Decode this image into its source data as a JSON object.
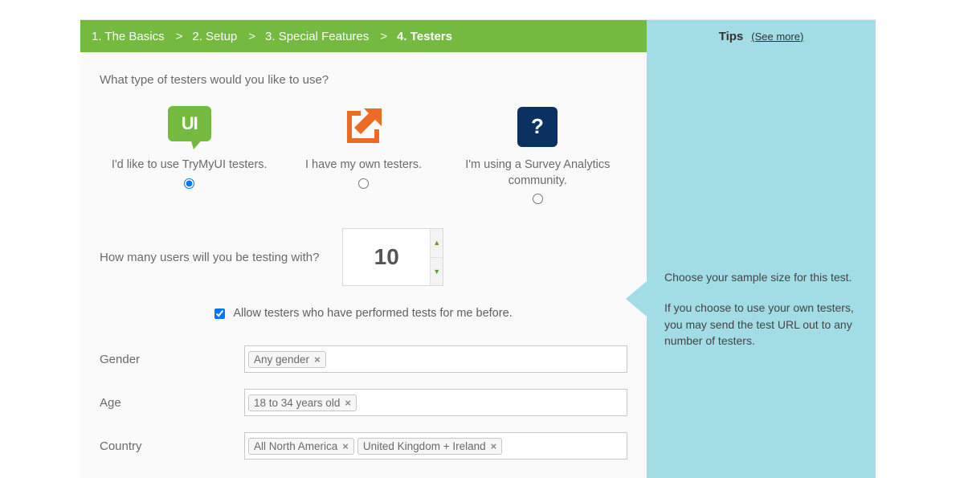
{
  "progress": {
    "steps": [
      "1. The Basics",
      "2. Setup",
      "3. Special Features",
      "4. Testers"
    ],
    "sep": ">",
    "current_index": 3
  },
  "tips": {
    "title": "Tips",
    "see_more": "(See more)",
    "line1": "Choose your sample size for this test.",
    "line2": "If you choose to use your own testers, you may send the test URL out to any number of testers."
  },
  "main": {
    "q_type": "What type of testers would you like to use?",
    "tester_options": {
      "ui": {
        "label": "I'd like to use TryMyUI testers.",
        "selected": true
      },
      "own": {
        "label": "I have my own testers.",
        "selected": false
      },
      "sa": {
        "label": "I'm using a Survey Analytics community.",
        "selected": false
      }
    },
    "q_count": "How many users will you be testing with?",
    "count_value": "10",
    "allow_repeat": {
      "checked": true,
      "label": "Allow testers who have performed tests for me before."
    },
    "filters": {
      "gender": {
        "label": "Gender",
        "tags": [
          "Any gender"
        ]
      },
      "age": {
        "label": "Age",
        "tags": [
          "18 to 34 years old"
        ]
      },
      "country": {
        "label": "Country",
        "tags": [
          "All North America",
          "United Kingdom + Ireland"
        ]
      }
    }
  }
}
